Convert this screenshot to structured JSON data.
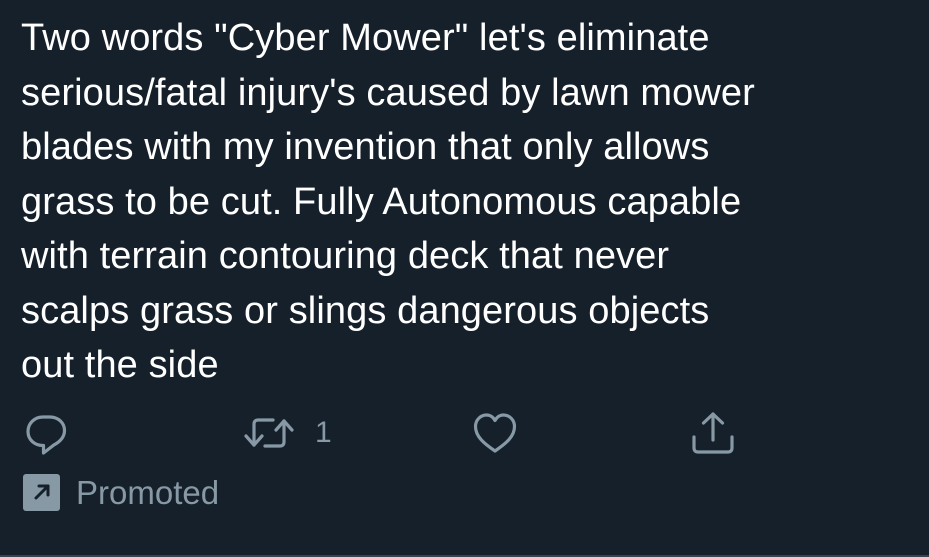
{
  "tweet": {
    "text_lines": [
      "Two words \"Cyber Mower\" let's eliminate",
      "serious/fatal injury's caused by lawn mower",
      "blades with my invention that only allows",
      "grass to be cut. Fully Autonomous capable",
      "with terrain contouring deck that never",
      "scalps grass or slings dangerous objects",
      "out the side"
    ],
    "actions": {
      "reply_icon": "reply-icon",
      "retweet_icon": "retweet-icon",
      "retweet_count": "1",
      "like_icon": "heart-icon",
      "share_icon": "share-icon"
    },
    "promoted": {
      "label": "Promoted",
      "icon": "promoted-arrow-icon"
    }
  },
  "colors": {
    "background": "#15202b",
    "text": "#ffffff",
    "secondary": "#8899a6",
    "divider": "#38444d"
  }
}
